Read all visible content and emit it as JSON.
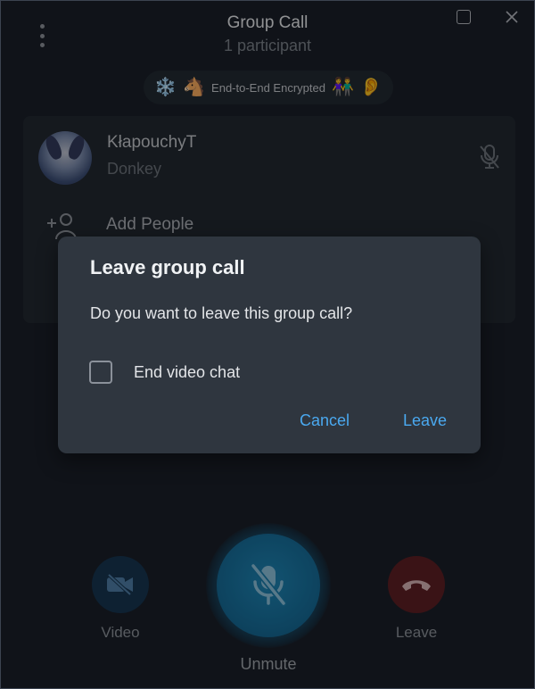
{
  "window": {
    "title": "Group Call",
    "subtitle": "1 participant"
  },
  "encryption": {
    "label": "End-to-End Encrypted",
    "emojis": [
      "❄️",
      "🐴",
      "👫",
      "👂"
    ]
  },
  "participants": [
    {
      "name": "KłapouchyT",
      "status": "Donkey",
      "muted": true
    }
  ],
  "panel": {
    "add_people_label": "Add People"
  },
  "dialog": {
    "title": "Leave group call",
    "message": "Do you want to leave this group call?",
    "checkbox_label": "End video chat",
    "checkbox_checked": false,
    "cancel_label": "Cancel",
    "leave_label": "Leave"
  },
  "controls": {
    "video_label": "Video",
    "unmute_label": "Unmute",
    "leave_label": "Leave"
  },
  "colors": {
    "accent": "#4aa9f0",
    "unmute": "#1a7fb0",
    "leave": "#5e1f24",
    "video": "#173652"
  }
}
